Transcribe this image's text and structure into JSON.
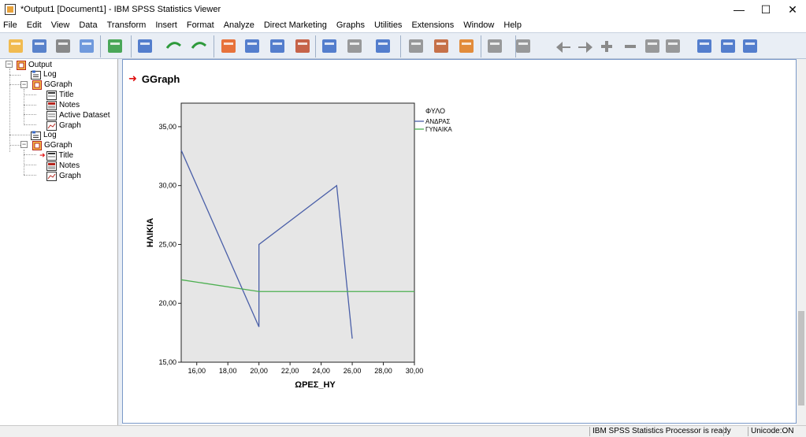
{
  "window": {
    "title": "*Output1 [Document1] - IBM SPSS Statistics Viewer",
    "minimize": "—",
    "maximize": "☐",
    "close": "✕"
  },
  "menu": [
    "File",
    "Edit",
    "View",
    "Data",
    "Transform",
    "Insert",
    "Format",
    "Analyze",
    "Direct Marketing",
    "Graphs",
    "Utilities",
    "Extensions",
    "Window",
    "Help"
  ],
  "toolbar_icons": [
    "open-icon",
    "save-icon",
    "print-icon",
    "print-preview-icon",
    "export-icon",
    "recall-dialog-icon",
    "undo-icon",
    "redo-icon",
    "goto-data-icon",
    "goto-case-icon",
    "goto-variable-icon",
    "variables-icon",
    "select-cases-icon",
    "weight-cases-icon",
    "split-file-icon",
    "scripting-icon",
    "designate-window-icon",
    "insert-heading-icon",
    "insert-title-icon",
    "insert-text-icon",
    "promote-icon",
    "demote-icon",
    "expand-icon",
    "collapse-icon",
    "show-icon",
    "hide-icon",
    "create-title-icon",
    "create-text-icon",
    "create-page-icon"
  ],
  "nav_tree": {
    "root": "Output",
    "log1": "Log",
    "ggraph1": "GGraph",
    "title1": "Title",
    "notes1": "Notes",
    "dataset1": "Active Dataset",
    "graph1": "Graph",
    "log2": "Log",
    "ggraph2": "GGraph",
    "title2": "Title",
    "notes2": "Notes",
    "graph2": "Graph"
  },
  "content": {
    "heading": "GGraph"
  },
  "chart_data": {
    "type": "line",
    "title": "",
    "xlabel": "ΩΡΕΣ_ΗΥ",
    "ylabel": "ΗΛΙΚΙΑ",
    "xlim": [
      15,
      30
    ],
    "ylim": [
      15,
      37
    ],
    "xticks": [
      16,
      18,
      20,
      22,
      24,
      26,
      28,
      30
    ],
    "yticks": [
      15,
      20,
      25,
      30,
      35
    ],
    "xtick_labels": [
      "16,00",
      "18,00",
      "20,00",
      "22,00",
      "24,00",
      "26,00",
      "28,00",
      "30,00"
    ],
    "ytick_labels": [
      "15,00",
      "20,00",
      "25,00",
      "30,00",
      "35,00"
    ],
    "legend_title": "ΦΥΛΟ",
    "legend_position": "right",
    "plot_background": "#e6e6e6",
    "series": [
      {
        "name": "ΑΝΔΡΑΣ",
        "color": "#4a5fa8",
        "points": [
          [
            15,
            33
          ],
          [
            20,
            18
          ],
          [
            20,
            25
          ],
          [
            25,
            30
          ],
          [
            26,
            17
          ]
        ]
      },
      {
        "name": "ΓΥΝΑΙΚΑ",
        "color": "#4caf50",
        "points": [
          [
            15,
            22
          ],
          [
            20,
            21
          ],
          [
            30,
            21
          ]
        ]
      }
    ]
  },
  "status": {
    "processor": "IBM SPSS Statistics Processor is ready",
    "unicode": "Unicode:ON"
  }
}
